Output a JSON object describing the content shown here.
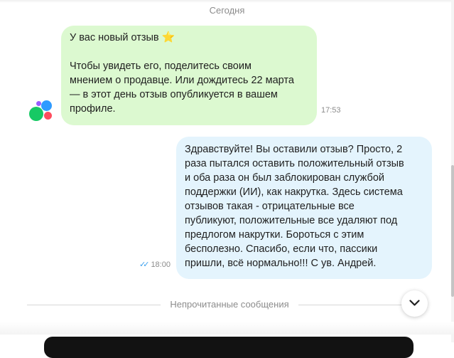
{
  "chat": {
    "date_separator": "Сегодня",
    "incoming": {
      "text_line1": "У вас новый отзыв",
      "star_icon": "⭐",
      "text_body": "Чтобы увидеть его, поделитесь своим\nмнением о продавце. Или дождитесь 22 марта\n— в этот день отзыв опубликуется в вашем\nпрофиле.",
      "time": "17:53",
      "sender_avatar": "multicolor-dots-logo"
    },
    "outgoing": {
      "text": "Здравствуйте! Вы оставили отзыв? Просто, 2\nраза пытался оставить положительный отзыв\nи оба раза он был заблокирован службой\nподдержки (ИИ), как накрутка. Здесь система\nотзывов такая - отрицательные все\nпубликуют, положительные все удаляют под\nпредлогом накрутки. Бороться с этим\nбесполезно. Спасибо, если что, пассики\nпришли, всё нормально!!! С ув. Андрей.",
      "time": "18:00",
      "status_icon": "double-check-read"
    },
    "unread_divider": "Непрочитанные сообщения"
  },
  "colors": {
    "incoming_bubble": "#dcf9d0",
    "outgoing_bubble": "#e4f4fd",
    "read_check": "#3aa0ee",
    "muted_text": "#8c8c8c"
  }
}
